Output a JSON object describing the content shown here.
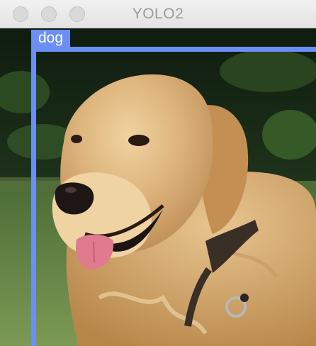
{
  "window": {
    "title": "YOLO2",
    "buttons": [
      "close",
      "minimize",
      "maximize"
    ]
  },
  "detection": {
    "label": "dog",
    "color": "#6b8ff5"
  },
  "image": {
    "subject": "golden-retriever-dog"
  }
}
